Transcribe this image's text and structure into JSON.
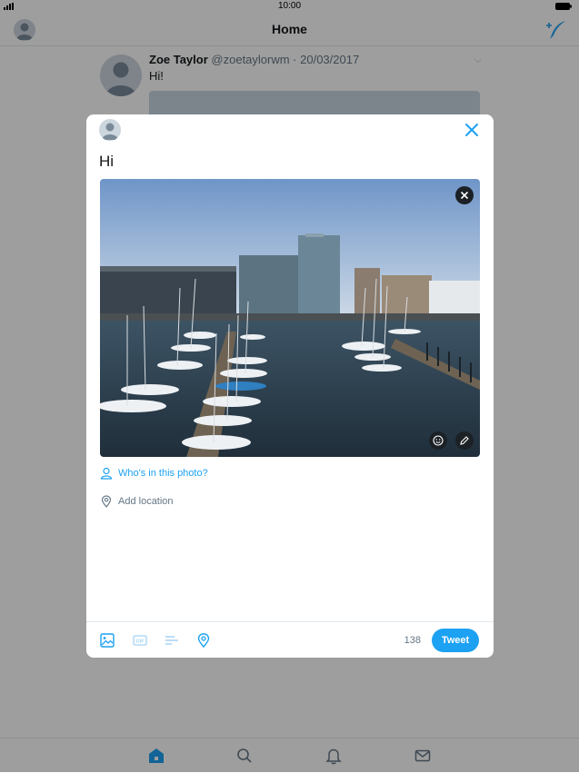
{
  "status_bar": {
    "time": "10:00"
  },
  "header": {
    "title": "Home"
  },
  "feed": {
    "tweet": {
      "name": "Zoe Taylor",
      "handle_date": "@zoetaylorwm · 20/03/2017",
      "text": "Hi!"
    }
  },
  "composer": {
    "text": "Hi",
    "tag_people_label": "Who's in this photo?",
    "add_location_label": "Add location",
    "char_count": "138",
    "tweet_button": "Tweet"
  },
  "icons": {
    "compose": "compose-tweet-icon",
    "close": "close-icon",
    "remove_photo": "remove-photo-icon",
    "sticker": "smiley-icon",
    "edit": "pencil-icon",
    "person": "person-icon",
    "location": "location-pin-icon",
    "image": "image-icon",
    "gif": "gif-icon",
    "poll": "poll-icon",
    "tabs": [
      "home-icon",
      "search-icon",
      "notifications-icon",
      "messages-icon"
    ]
  },
  "colors": {
    "accent": "#1da1f2",
    "text": "#14171a",
    "secondary_text": "#657786",
    "divider": "#e1e8ed"
  }
}
